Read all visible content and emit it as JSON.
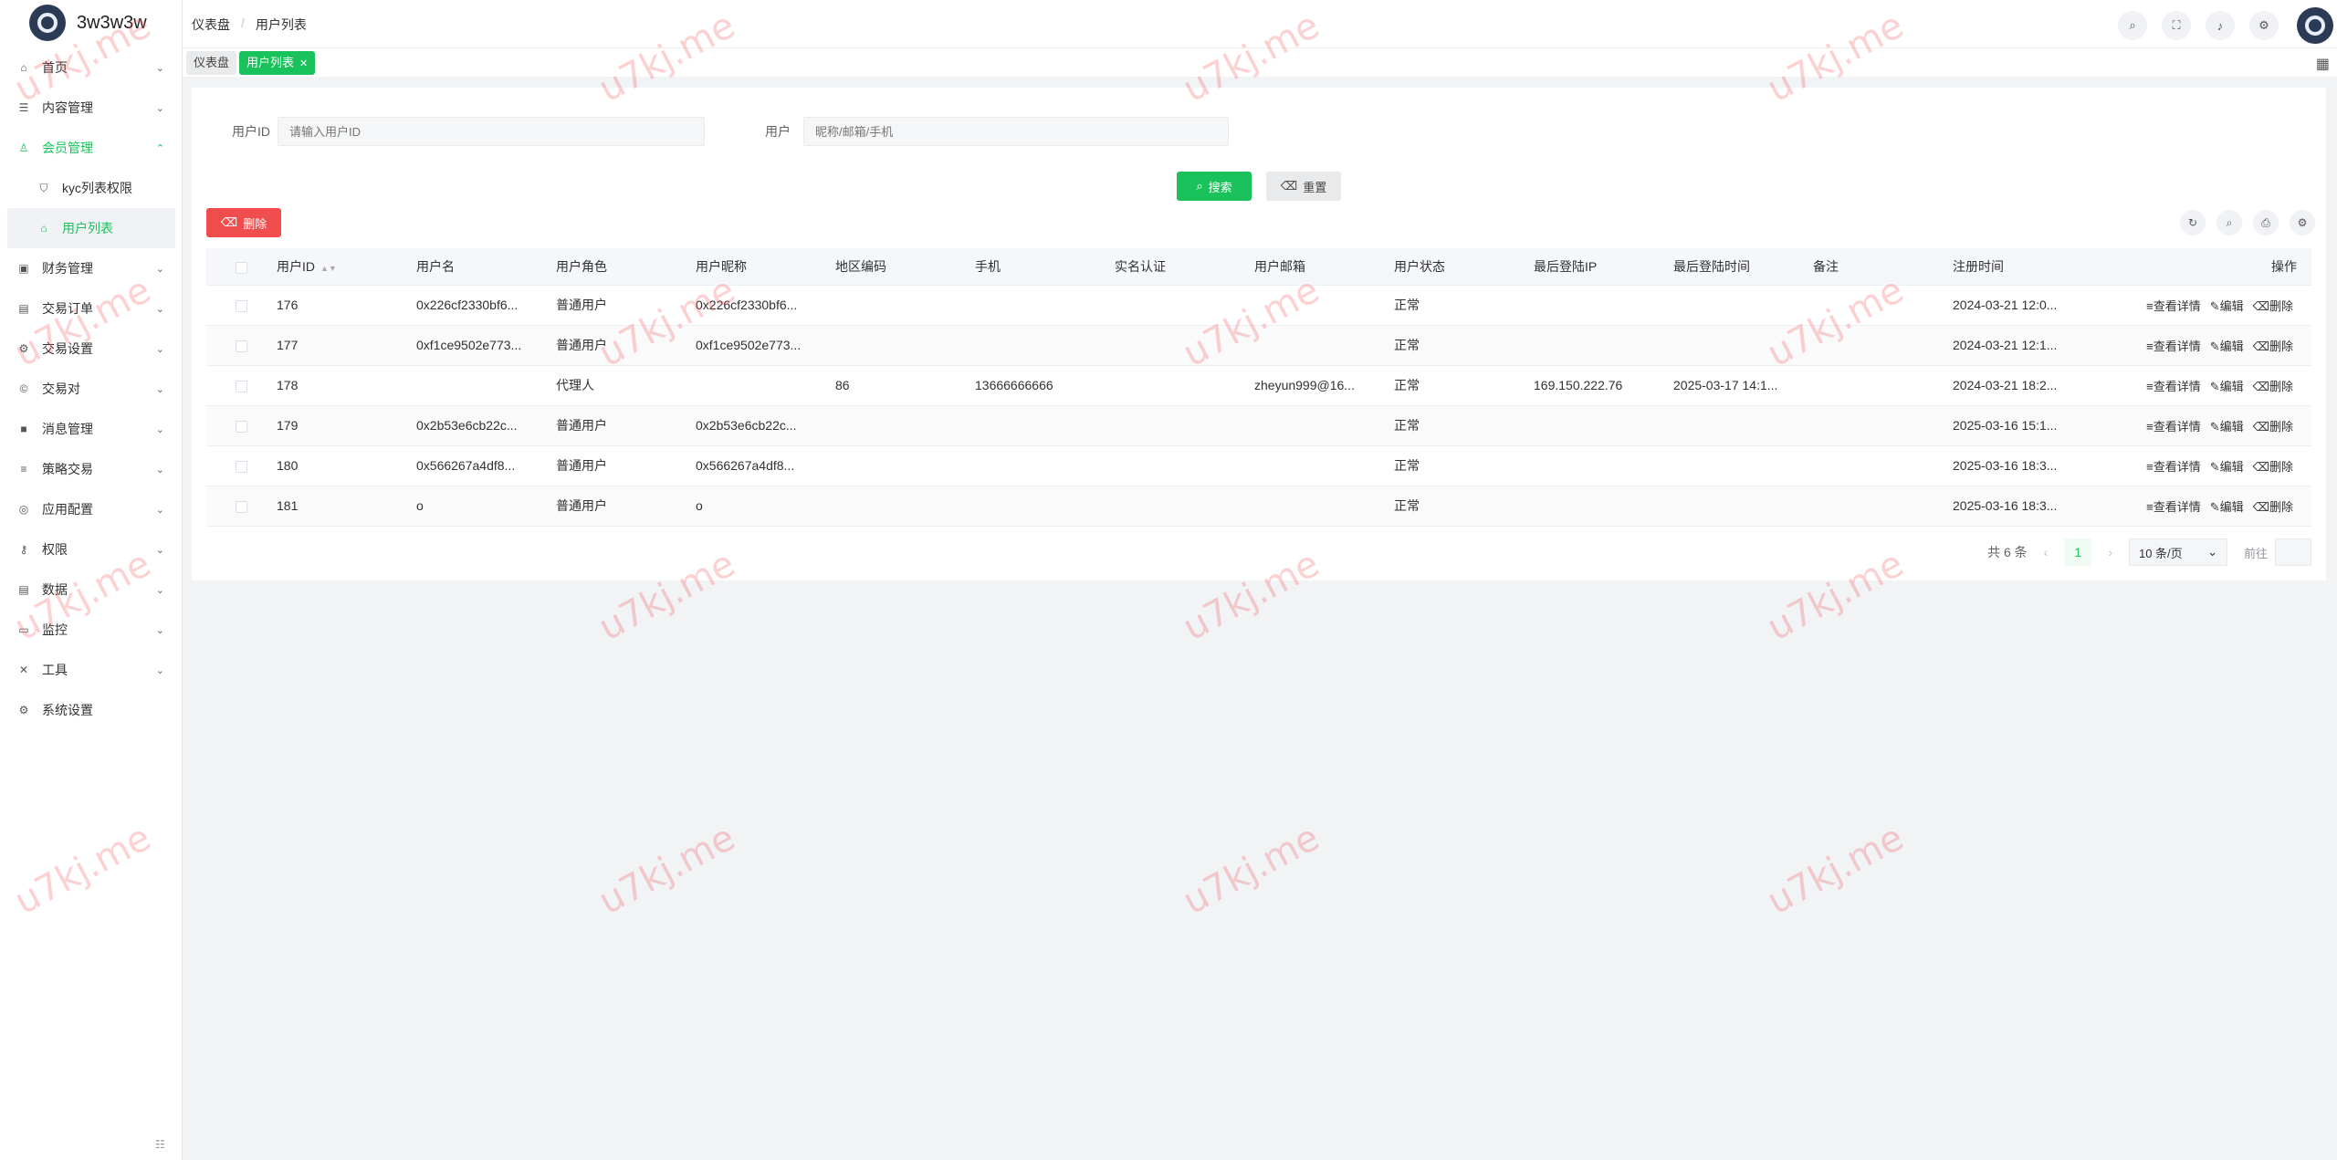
{
  "app": {
    "name": "3w3w3w"
  },
  "breadcrumb": [
    "仪表盘",
    "用户列表"
  ],
  "tags": {
    "dashboard": "仪表盘",
    "active": "用户列表"
  },
  "sidebar": {
    "items": [
      {
        "label": "首页",
        "icon": "home-icon",
        "glyph": "⌂",
        "chevron": "⌄"
      },
      {
        "label": "内容管理",
        "icon": "list-icon",
        "glyph": "☰",
        "chevron": "⌄"
      },
      {
        "label": "会员管理",
        "icon": "user-icon",
        "glyph": "♙",
        "chevron": "⌃"
      },
      {
        "label": "kyc列表权限",
        "icon": "shield-icon",
        "glyph": "⛉"
      },
      {
        "label": "用户列表",
        "icon": "home-icon",
        "glyph": "⌂"
      },
      {
        "label": "财务管理",
        "icon": "wallet-icon",
        "glyph": "▣",
        "chevron": "⌄"
      },
      {
        "label": "交易订单",
        "icon": "table-icon",
        "glyph": "▤",
        "chevron": "⌄"
      },
      {
        "label": "交易设置",
        "icon": "tool-icon",
        "glyph": "⚙",
        "chevron": "⌄"
      },
      {
        "label": "交易对",
        "icon": "coin-icon",
        "glyph": "©",
        "chevron": "⌄"
      },
      {
        "label": "消息管理",
        "icon": "message-icon",
        "glyph": "■",
        "chevron": "⌄"
      },
      {
        "label": "策略交易",
        "icon": "menu-icon",
        "glyph": "≡",
        "chevron": "⌄"
      },
      {
        "label": "应用配置",
        "icon": "config-icon",
        "glyph": "◎",
        "chevron": "⌄"
      },
      {
        "label": "权限",
        "icon": "key-icon",
        "glyph": "⚷",
        "chevron": "⌄"
      },
      {
        "label": "数据",
        "icon": "data-icon",
        "glyph": "▤",
        "chevron": "⌄"
      },
      {
        "label": "监控",
        "icon": "monitor-icon",
        "glyph": "▭",
        "chevron": "⌄"
      },
      {
        "label": "工具",
        "icon": "wrench-icon",
        "glyph": "✕",
        "chevron": "⌄"
      },
      {
        "label": "系统设置",
        "icon": "gear-icon",
        "glyph": "⚙"
      }
    ]
  },
  "search": {
    "user_id_label": "用户ID",
    "user_id_placeholder": "请输入用户ID",
    "user_label": "用户",
    "user_placeholder": "昵称/邮箱/手机",
    "search_label": "搜索",
    "reset_label": "重置"
  },
  "toolbar": {
    "delete_label": "删除"
  },
  "table": {
    "headers": [
      "用户ID",
      "用户名",
      "用户角色",
      "用户昵称",
      "地区编码",
      "手机",
      "实名认证",
      "用户邮箱",
      "用户状态",
      "最后登陆IP",
      "最后登陆时间",
      "备注",
      "注册时间",
      "操作"
    ],
    "rows": [
      [
        "176",
        "0x226cf2330bf6...",
        "普通用户",
        "0x226cf2330bf6...",
        "",
        "",
        "",
        "",
        "正常",
        "",
        "",
        "",
        "2024-03-21 12:0..."
      ],
      [
        "177",
        "0xf1ce9502e773...",
        "普通用户",
        "0xf1ce9502e773...",
        "",
        "",
        "",
        "",
        "正常",
        "",
        "",
        "",
        "2024-03-21 12:1..."
      ],
      [
        "178",
        "",
        "代理人",
        "",
        "86",
        "13666666666",
        "",
        "zheyun999@16...",
        "正常",
        "169.150.222.76",
        "2025-03-17 14:1...",
        "",
        "2024-03-21 18:2..."
      ],
      [
        "179",
        "0x2b53e6cb22c...",
        "普通用户",
        "0x2b53e6cb22c...",
        "",
        "",
        "",
        "",
        "正常",
        "",
        "",
        "",
        "2025-03-16 15:1..."
      ],
      [
        "180",
        "0x566267a4df8...",
        "普通用户",
        "0x566267a4df8...",
        "",
        "",
        "",
        "",
        "正常",
        "",
        "",
        "",
        "2025-03-16 18:3..."
      ],
      [
        "181",
        "o",
        "普通用户",
        "o",
        "",
        "",
        "",
        "",
        "正常",
        "",
        "",
        "",
        "2025-03-16 18:3..."
      ]
    ],
    "ops": {
      "view": "≡查看详情",
      "edit": "✎编辑",
      "delete": "⌫删除"
    }
  },
  "pagination": {
    "total": "共 6 条",
    "current": "1",
    "page_size": "10 条/页",
    "goto": "前往"
  },
  "watermark": "u7kj.me",
  "colors": {
    "accent": "#19c25a",
    "danger": "#f04e4e"
  }
}
